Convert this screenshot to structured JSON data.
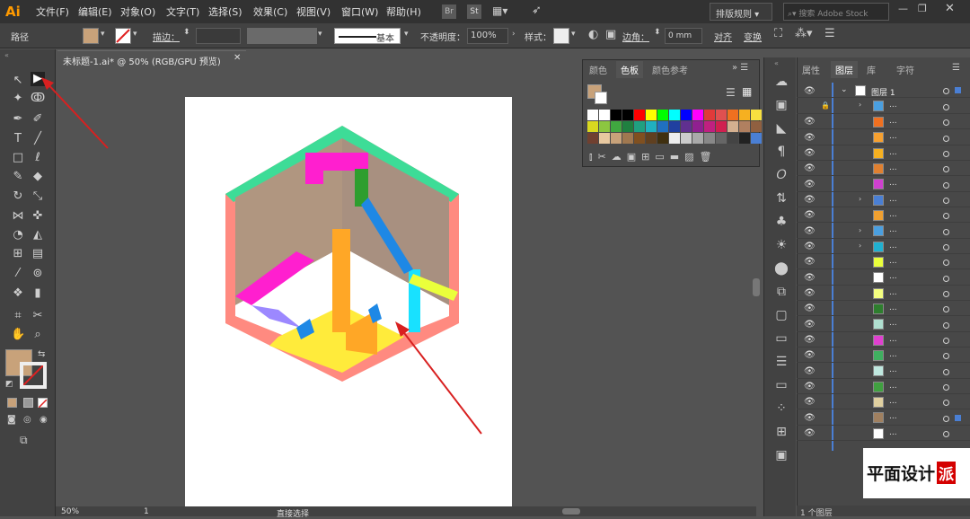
{
  "app": {
    "logo": "Ai"
  },
  "menu": [
    "文件(F)",
    "编辑(E)",
    "对象(O)",
    "文字(T)",
    "选择(S)",
    "效果(C)",
    "视图(V)",
    "窗口(W)",
    "帮助(H)"
  ],
  "topbar": {
    "workspace": "排版规则",
    "search_placeholder": "搜索 Adobe Stock",
    "st_badge": "St"
  },
  "control": {
    "selection_label": "路径",
    "stroke_label": "描边：",
    "stroke_style": "基本",
    "opacity_label": "不透明度：",
    "opacity_value": "100%",
    "style_label": "样式：",
    "corner_label": "边角：",
    "corner_value": "0 mm",
    "align_label": "对齐",
    "transform_label": "变换"
  },
  "document": {
    "tab_title": "未标题-1.ai* @ 50% (RGB/GPU 预览)"
  },
  "status": {
    "zoom": "50%",
    "page": "1",
    "tool": "直接选择"
  },
  "swatches": {
    "tabs": [
      "颜色",
      "色板",
      "颜色参考"
    ],
    "active_tab": "色板"
  },
  "layers": {
    "tabs": [
      "属性",
      "图层",
      "库",
      "字符"
    ],
    "active_tab": "图层",
    "layer_name": "图层 1",
    "item_label": "...",
    "footer": "1 个图层"
  },
  "colors": {
    "fill": "#c8a27a",
    "accent": "#4a7fd4"
  },
  "watermark": {
    "text": "平面设计",
    "badge": "派"
  }
}
